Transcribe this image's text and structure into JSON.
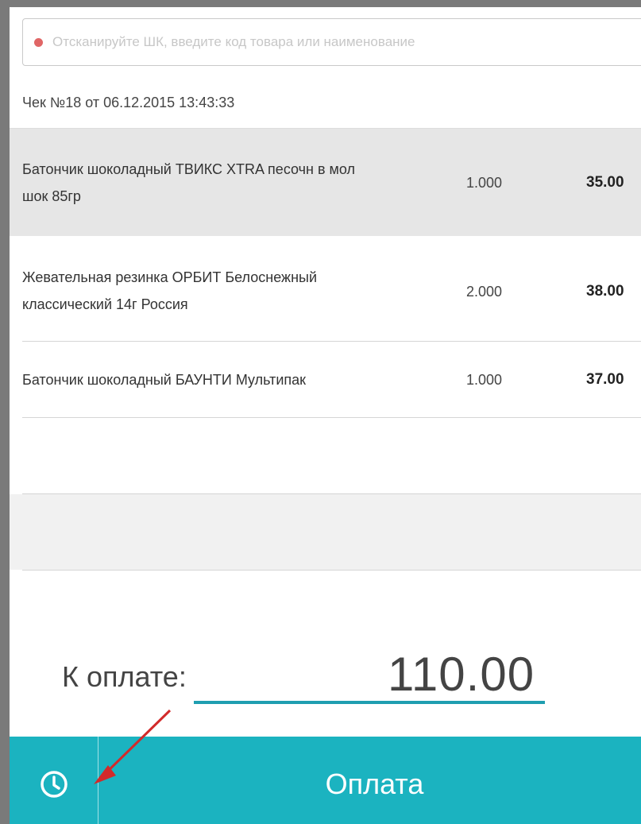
{
  "search": {
    "placeholder": "Отсканируйте ШК, введите код товара или наименование",
    "value": ""
  },
  "receipt": {
    "title": "Чек №18 от 06.12.2015 13:43:33"
  },
  "items": [
    {
      "name_line1": "Батончик шоколадный ТВИКС XTRA песочн в мол",
      "name_line2": "шок 85гр",
      "qty": "1.000",
      "price": "35.00"
    },
    {
      "name_line1": "Жевательная резинка ОРБИТ Белоснежный",
      "name_line2": "классический 14г Россия",
      "qty": "2.000",
      "price": "38.00"
    },
    {
      "name_line1": "Батончик шоколадный БАУНТИ Мультипак",
      "name_line2": "",
      "qty": "1.000",
      "price": "37.00"
    }
  ],
  "total": {
    "label": "К оплате:",
    "value": "110.00"
  },
  "actions": {
    "pay_label": "Оплата",
    "history_icon": "clock-icon"
  },
  "colors": {
    "accent": "#1bb3c0",
    "underline": "#1f9eb0",
    "status_dot": "#e06666",
    "selected_row": "#e6e6e6"
  }
}
